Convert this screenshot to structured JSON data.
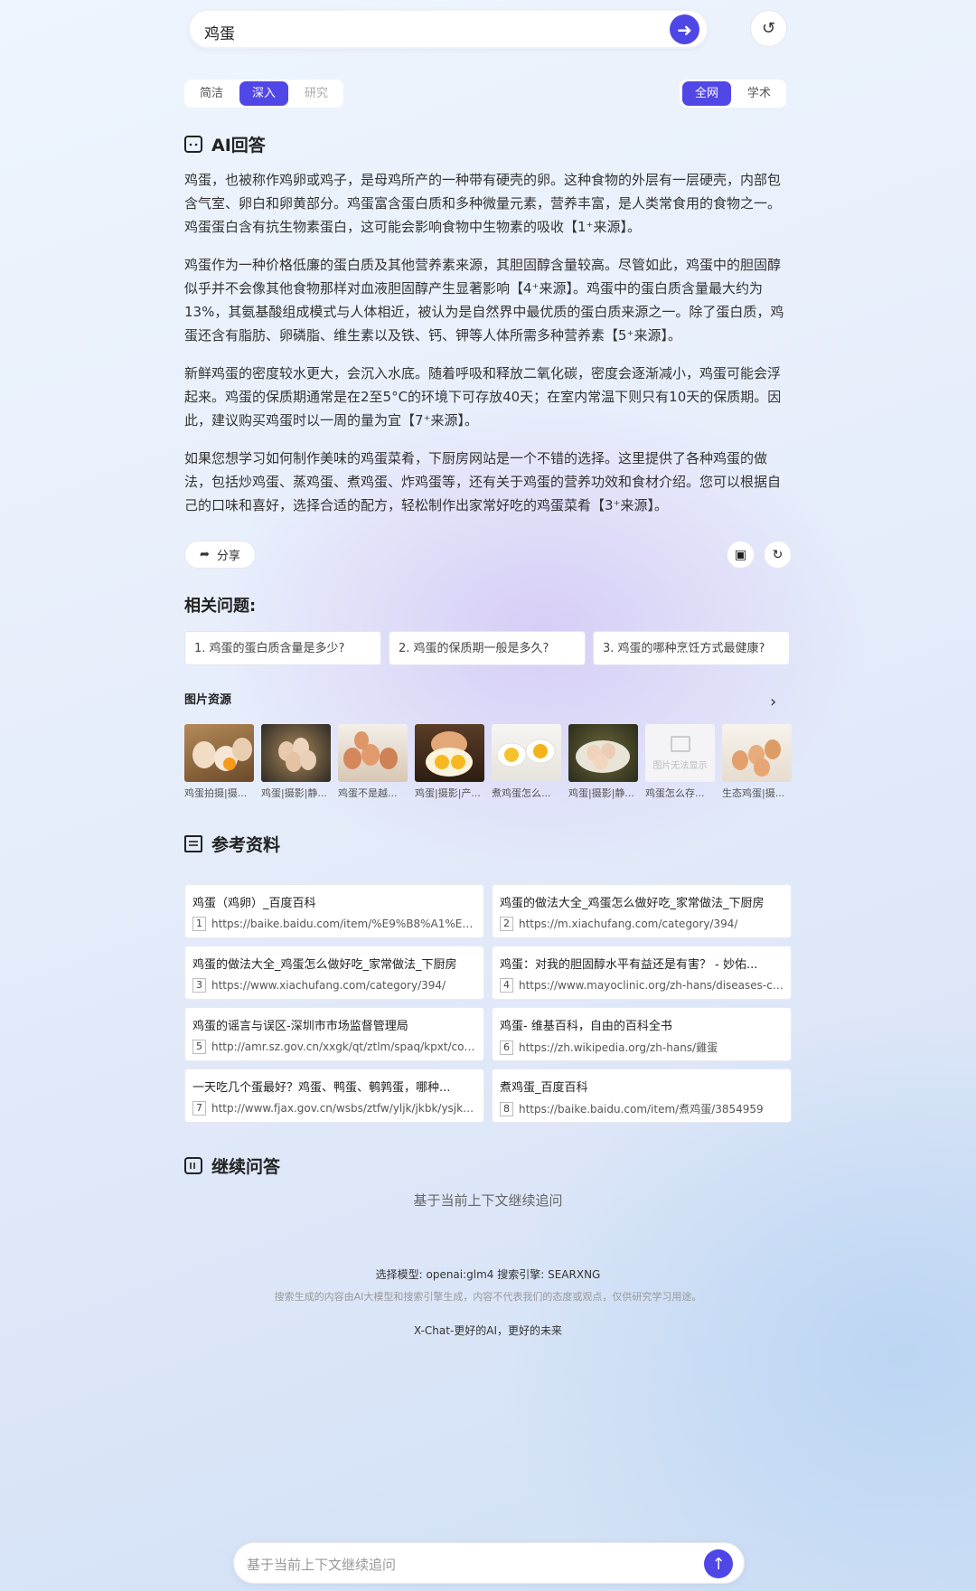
{
  "search": {
    "query": "鸡蛋"
  },
  "modes": {
    "left": [
      "简洁",
      "深入",
      "研究"
    ],
    "left_active": 1,
    "right": [
      "全网",
      "学术"
    ],
    "right_active": 0
  },
  "answer_section": {
    "title": "AI回答",
    "paragraphs": [
      "鸡蛋，也被称作鸡卵或鸡子，是母鸡所产的一种带有硬壳的卵。这种食物的外层有一层硬壳，内部包含气室、卵白和卵黄部分。鸡蛋富含蛋白质和多种微量元素，营养丰富，是人类常食用的食物之一。鸡蛋蛋白含有抗生物素蛋白，这可能会影响食物中生物素的吸收【1⁺来源】。",
      "鸡蛋作为一种价格低廉的蛋白质及其他营养素来源，其胆固醇含量较高。尽管如此，鸡蛋中的胆固醇似乎并不会像其他食物那样对血液胆固醇产生显著影响【4⁺来源】。鸡蛋中的蛋白质含量最大约为13%，其氨基酸组成模式与人体相近，被认为是自然界中最优质的蛋白质来源之一。除了蛋白质，鸡蛋还含有脂肪、卵磷脂、维生素以及铁、钙、钾等人体所需多种营养素【5⁺来源】。",
      "新鲜鸡蛋的密度较水更大，会沉入水底。随着呼吸和释放二氧化碳，密度会逐渐减小，鸡蛋可能会浮起来。鸡蛋的保质期通常是在2至5°C的环境下可存放40天；在室内常温下则只有10天的保质期。因此，建议购买鸡蛋时以一周的量为宜【7⁺来源】。",
      "如果您想学习如何制作美味的鸡蛋菜肴，下厨房网站是一个不错的选择。这里提供了各种鸡蛋的做法，包括炒鸡蛋、蒸鸡蛋、煮鸡蛋、炸鸡蛋等，还有关于鸡蛋的营养功效和食材介绍。您可以根据自己的口味和喜好，选择合适的配方，轻松制作出家常好吃的鸡蛋菜肴【3⁺来源】。"
    ],
    "share_label": "分享"
  },
  "related": {
    "title": "相关问题:",
    "questions": [
      "1. 鸡蛋的蛋白质含量是多少?",
      "2. 鸡蛋的保质期一般是多久?",
      "3. 鸡蛋的哪种烹饪方式最健康?"
    ]
  },
  "images": {
    "title": "图片资源",
    "items": [
      {
        "caption": "鸡蛋拍摄|摄...",
        "kind": "nest"
      },
      {
        "caption": "鸡蛋|摄影|静...",
        "kind": "basket"
      },
      {
        "caption": "鸡蛋不是越...",
        "kind": "crate"
      },
      {
        "caption": "鸡蛋|摄影|产...",
        "kind": "yolk"
      },
      {
        "caption": "煮鸡蛋怎么...",
        "kind": "boiled"
      },
      {
        "caption": "鸡蛋|摄影|静...",
        "kind": "bowl"
      },
      {
        "caption": "鸡蛋怎么存...",
        "kind": "missing",
        "missing_text": "图片无法显示"
      },
      {
        "caption": "生态鸡蛋|摄...",
        "kind": "tray"
      }
    ]
  },
  "references": {
    "title": "参考资料",
    "items": [
      {
        "n": "1",
        "title": "鸡蛋（鸡卵）_百度百科",
        "url": "https://baike.baidu.com/item/%E9%B8%A1%E8%9B%8B/..."
      },
      {
        "n": "2",
        "title": "鸡蛋的做法大全_鸡蛋怎么做好吃_家常做法_下厨房",
        "url": "https://m.xiachufang.com/category/394/"
      },
      {
        "n": "3",
        "title": "鸡蛋的做法大全_鸡蛋怎么做好吃_家常做法_下厨房",
        "url": "https://www.xiachufang.com/category/394/"
      },
      {
        "n": "4",
        "title": "鸡蛋：对我的胆固醇水平有益还是有害？ - 妙佑...",
        "url": "https://www.mayoclinic.org/zh-hans/diseases-co..."
      },
      {
        "n": "5",
        "title": "鸡蛋的谣言与误区-深圳市市场监督管理局",
        "url": "http://amr.sz.gov.cn/xxgk/qt/ztlm/spaq/kpxt/cont..."
      },
      {
        "n": "6",
        "title": "鸡蛋- 维基百科，自由的百科全书",
        "url": "https://zh.wikipedia.org/zh-hans/雞蛋"
      },
      {
        "n": "7",
        "title": "一天吃几个蛋最好？鸡蛋、鸭蛋、鹌鹑蛋，哪种...",
        "url": "http://www.fjax.gov.cn/wsbs/ztfw/yljk/jkbk/ysjk/..."
      },
      {
        "n": "8",
        "title": "煮鸡蛋_百度百科",
        "url": "https://baike.baidu.com/item/煮鸡蛋/3854959"
      }
    ]
  },
  "followup": {
    "title": "继续问答",
    "hint": "基于当前上下文继续追问"
  },
  "footer": {
    "line1": "选择模型: openai:glm4  搜索引擎: SEARXNG",
    "line2": "搜索生成的内容由AI大模型和搜索引擎生成，内容不代表我们的态度或观点，仅供研究学习用途。",
    "line3": "X-Chat-更好的AI，更好的未来"
  },
  "bottom_input": {
    "placeholder": "基于当前上下文继续追问"
  },
  "colors": {
    "accent": "#4e46e5"
  }
}
